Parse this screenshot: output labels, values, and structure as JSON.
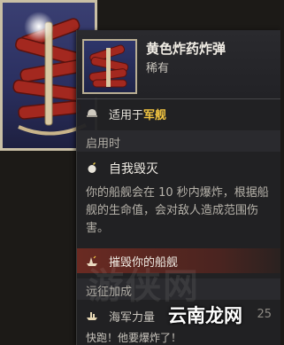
{
  "item": {
    "name": "黄色炸药炸弹",
    "rarity": "稀有",
    "icon": "dynamite-bundle-icon"
  },
  "applies_to": {
    "prefix": "适用于",
    "target": "军舰",
    "icon": "helmet-icon"
  },
  "sections": {
    "on_use": "启用时",
    "expedition_bonus": "远征加成"
  },
  "ability": {
    "name": "自我毁灭",
    "icon": "bomb-icon",
    "description": "你的船舰会在 10 秒内爆炸，根据船舰的生命值，会对敌人造成范围伤害。"
  },
  "effect": {
    "label": "摧毁你的船舰",
    "icon": "ship-wreck-icon"
  },
  "bonus": {
    "label": "海军力量",
    "value": "25",
    "icon": "fleet-icon"
  },
  "flavor_text": "快跑！他要爆炸了！",
  "watermark": "游侠网",
  "site_tag": "云南龙网",
  "colors": {
    "highlight": "#f2c541",
    "tooltip_bg": "#212124",
    "destroy_bar": "#6a2a22",
    "slot_blue": "#2b3061"
  }
}
